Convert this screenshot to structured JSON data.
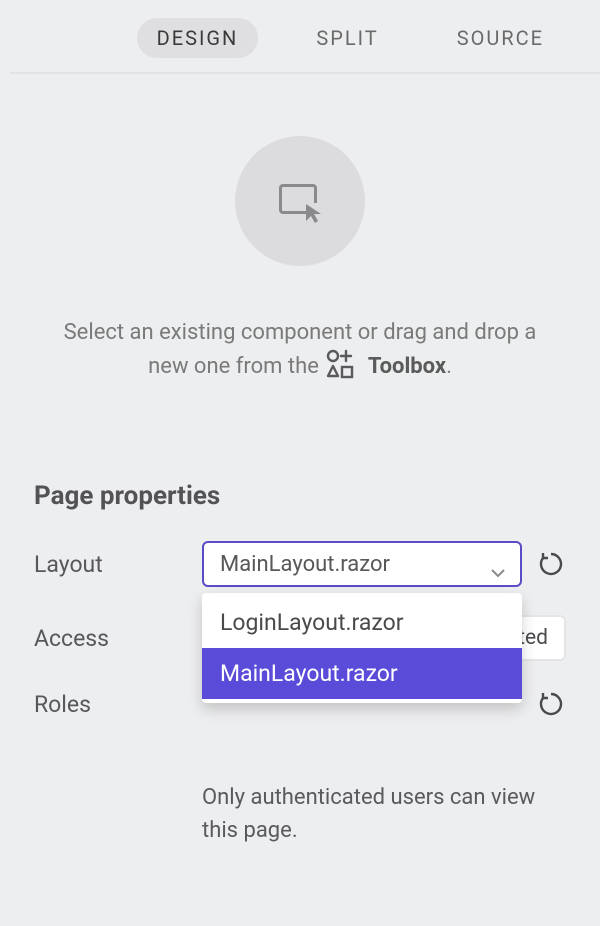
{
  "tabs": {
    "design": "DESIGN",
    "split": "SPLIT",
    "source": "SOURCE"
  },
  "instruction": {
    "part1": "Select an existing component or drag and drop a new one from the",
    "toolbox_word": "Toolbox",
    "dot": "."
  },
  "section_title": "Page properties",
  "layout": {
    "label": "Layout",
    "value": "MainLayout.razor",
    "options": [
      "LoginLayout.razor",
      "MainLayout.razor"
    ]
  },
  "access": {
    "label": "Access",
    "pill_text_suffix": "ted"
  },
  "roles": {
    "label": "Roles"
  },
  "help": "Only authenticated users can view this page."
}
